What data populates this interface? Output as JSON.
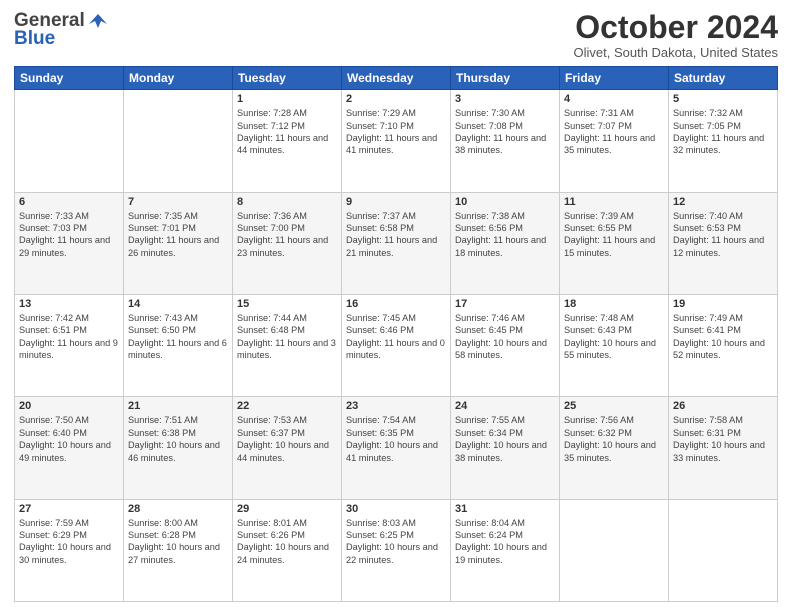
{
  "header": {
    "logo_general": "General",
    "logo_blue": "Blue",
    "month_title": "October 2024",
    "location": "Olivet, South Dakota, United States"
  },
  "days_of_week": [
    "Sunday",
    "Monday",
    "Tuesday",
    "Wednesday",
    "Thursday",
    "Friday",
    "Saturday"
  ],
  "weeks": [
    [
      {
        "day": "",
        "info": ""
      },
      {
        "day": "",
        "info": ""
      },
      {
        "day": "1",
        "info": "Sunrise: 7:28 AM\nSunset: 7:12 PM\nDaylight: 11 hours and 44 minutes."
      },
      {
        "day": "2",
        "info": "Sunrise: 7:29 AM\nSunset: 7:10 PM\nDaylight: 11 hours and 41 minutes."
      },
      {
        "day": "3",
        "info": "Sunrise: 7:30 AM\nSunset: 7:08 PM\nDaylight: 11 hours and 38 minutes."
      },
      {
        "day": "4",
        "info": "Sunrise: 7:31 AM\nSunset: 7:07 PM\nDaylight: 11 hours and 35 minutes."
      },
      {
        "day": "5",
        "info": "Sunrise: 7:32 AM\nSunset: 7:05 PM\nDaylight: 11 hours and 32 minutes."
      }
    ],
    [
      {
        "day": "6",
        "info": "Sunrise: 7:33 AM\nSunset: 7:03 PM\nDaylight: 11 hours and 29 minutes."
      },
      {
        "day": "7",
        "info": "Sunrise: 7:35 AM\nSunset: 7:01 PM\nDaylight: 11 hours and 26 minutes."
      },
      {
        "day": "8",
        "info": "Sunrise: 7:36 AM\nSunset: 7:00 PM\nDaylight: 11 hours and 23 minutes."
      },
      {
        "day": "9",
        "info": "Sunrise: 7:37 AM\nSunset: 6:58 PM\nDaylight: 11 hours and 21 minutes."
      },
      {
        "day": "10",
        "info": "Sunrise: 7:38 AM\nSunset: 6:56 PM\nDaylight: 11 hours and 18 minutes."
      },
      {
        "day": "11",
        "info": "Sunrise: 7:39 AM\nSunset: 6:55 PM\nDaylight: 11 hours and 15 minutes."
      },
      {
        "day": "12",
        "info": "Sunrise: 7:40 AM\nSunset: 6:53 PM\nDaylight: 11 hours and 12 minutes."
      }
    ],
    [
      {
        "day": "13",
        "info": "Sunrise: 7:42 AM\nSunset: 6:51 PM\nDaylight: 11 hours and 9 minutes."
      },
      {
        "day": "14",
        "info": "Sunrise: 7:43 AM\nSunset: 6:50 PM\nDaylight: 11 hours and 6 minutes."
      },
      {
        "day": "15",
        "info": "Sunrise: 7:44 AM\nSunset: 6:48 PM\nDaylight: 11 hours and 3 minutes."
      },
      {
        "day": "16",
        "info": "Sunrise: 7:45 AM\nSunset: 6:46 PM\nDaylight: 11 hours and 0 minutes."
      },
      {
        "day": "17",
        "info": "Sunrise: 7:46 AM\nSunset: 6:45 PM\nDaylight: 10 hours and 58 minutes."
      },
      {
        "day": "18",
        "info": "Sunrise: 7:48 AM\nSunset: 6:43 PM\nDaylight: 10 hours and 55 minutes."
      },
      {
        "day": "19",
        "info": "Sunrise: 7:49 AM\nSunset: 6:41 PM\nDaylight: 10 hours and 52 minutes."
      }
    ],
    [
      {
        "day": "20",
        "info": "Sunrise: 7:50 AM\nSunset: 6:40 PM\nDaylight: 10 hours and 49 minutes."
      },
      {
        "day": "21",
        "info": "Sunrise: 7:51 AM\nSunset: 6:38 PM\nDaylight: 10 hours and 46 minutes."
      },
      {
        "day": "22",
        "info": "Sunrise: 7:53 AM\nSunset: 6:37 PM\nDaylight: 10 hours and 44 minutes."
      },
      {
        "day": "23",
        "info": "Sunrise: 7:54 AM\nSunset: 6:35 PM\nDaylight: 10 hours and 41 minutes."
      },
      {
        "day": "24",
        "info": "Sunrise: 7:55 AM\nSunset: 6:34 PM\nDaylight: 10 hours and 38 minutes."
      },
      {
        "day": "25",
        "info": "Sunrise: 7:56 AM\nSunset: 6:32 PM\nDaylight: 10 hours and 35 minutes."
      },
      {
        "day": "26",
        "info": "Sunrise: 7:58 AM\nSunset: 6:31 PM\nDaylight: 10 hours and 33 minutes."
      }
    ],
    [
      {
        "day": "27",
        "info": "Sunrise: 7:59 AM\nSunset: 6:29 PM\nDaylight: 10 hours and 30 minutes."
      },
      {
        "day": "28",
        "info": "Sunrise: 8:00 AM\nSunset: 6:28 PM\nDaylight: 10 hours and 27 minutes."
      },
      {
        "day": "29",
        "info": "Sunrise: 8:01 AM\nSunset: 6:26 PM\nDaylight: 10 hours and 24 minutes."
      },
      {
        "day": "30",
        "info": "Sunrise: 8:03 AM\nSunset: 6:25 PM\nDaylight: 10 hours and 22 minutes."
      },
      {
        "day": "31",
        "info": "Sunrise: 8:04 AM\nSunset: 6:24 PM\nDaylight: 10 hours and 19 minutes."
      },
      {
        "day": "",
        "info": ""
      },
      {
        "day": "",
        "info": ""
      }
    ]
  ]
}
